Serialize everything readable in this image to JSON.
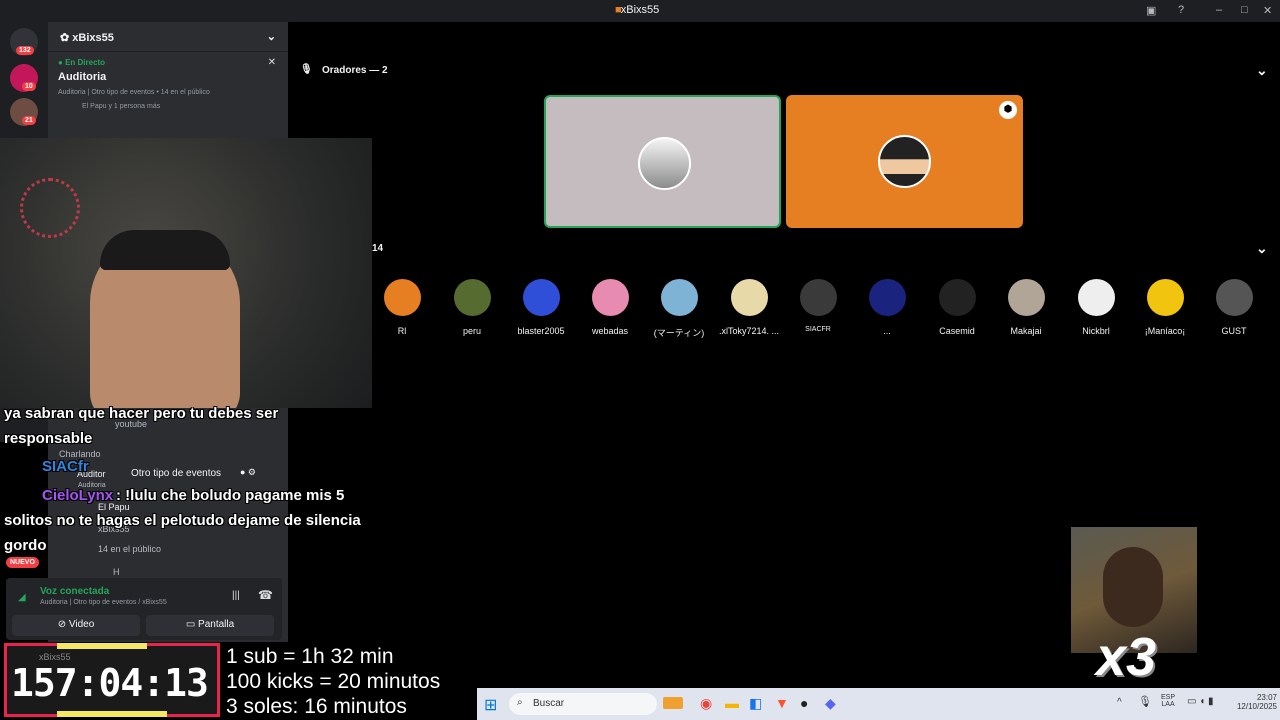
{
  "titlebar": {
    "title": "xBixs55"
  },
  "guilds": [
    {
      "badge": "132"
    },
    {
      "badge": "10"
    },
    {
      "badge": "21"
    }
  ],
  "sidebar": {
    "server_name": "xBixs55",
    "live_label": "En Directo",
    "stage_name": "Auditoria",
    "stage_meta": "Auditoria | Otro tipo de eventos • 14 en el público",
    "stage_people": "El Papu y 1 persona más",
    "channel_youtube": "youtube",
    "category": "Charlando",
    "event_channel": "Auditor",
    "event_type": "Otro tipo de eventos",
    "event_sub": "Auditoria",
    "member1": "El Papu",
    "member2": "xBixs55",
    "audience_count": "14 en el público",
    "h_label": "H",
    "new_badge": "NUEVO",
    "voice_status": "Voz conectada",
    "voice_path": "Auditoria | Otro tipo de eventos / xBixs55",
    "video_label": "Video",
    "screen_label": "Pantalla",
    "user_name": "xBixs55"
  },
  "main": {
    "speakers_header": "Oradores — 2",
    "audience_header": "14",
    "audience": [
      "Rl",
      "peru",
      "blaster2005",
      "webadas",
      "(マーティン)",
      "‎.xlToky7214‎. ...",
      "SIACFR",
      "...",
      "Casemid",
      "Makajai",
      "Nickbrl",
      "¡Maníaco¡",
      "GUST"
    ]
  },
  "stream_chat": [
    {
      "user": "",
      "text": "ya sabran que hacer pero tu debes ser"
    },
    {
      "user": "",
      "text": "responsable"
    },
    {
      "user": "SIACfr",
      "text": ""
    },
    {
      "user": "CieloLynx",
      "text": ": !lulu che boludo pagame mis 5"
    },
    {
      "user": "",
      "text": "solitos no te hagas el pelotudo dejame de silencia"
    },
    {
      "user": "",
      "text": "gordo"
    }
  ],
  "timer": {
    "value": "157:04:13",
    "user": "xBixs55"
  },
  "rules": [
    "1 sub = 1h 32 min",
    "100 kicks = 20 minutos",
    "3 soles: 16 minutos"
  ],
  "taskbar": {
    "search": "Buscar",
    "lang1": "ESP",
    "lang2": "LAA",
    "time": "23:07",
    "date": "12/10/2025"
  },
  "multiplier": "x3",
  "colors": {
    "accent_green": "#23a55a",
    "orange_tile": "#e67e22",
    "grey_tile": "#c4bcbe",
    "timer_border": "#e8244f"
  }
}
